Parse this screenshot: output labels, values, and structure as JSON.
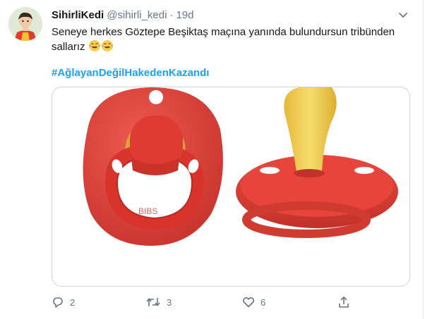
{
  "tweet": {
    "display_name": "SihirliKedi",
    "handle": "@sihirli_kedi",
    "separator": "·",
    "time": "19d",
    "text_line1": "Seneye herkes  Göztepe Beşiktaş maçına yanında bulundursun tribünden",
    "text_line2": "sallarız",
    "hashtag": "#AğlayanDeğilHakedenKazandı"
  },
  "actions": {
    "reply_count": "2",
    "retweet_count": "3",
    "like_count": "6"
  },
  "icons": {
    "reply": "reply-icon",
    "retweet": "retweet-icon",
    "like": "heart-icon",
    "share": "share-icon",
    "more": "chevron-down-icon",
    "emoji": "face-with-tears-of-joy"
  },
  "colors": {
    "link": "#1da1f2",
    "secondary_text": "#657786",
    "pacifier_red": "#e0413a",
    "nipple_yellow": "#e9c74a"
  }
}
